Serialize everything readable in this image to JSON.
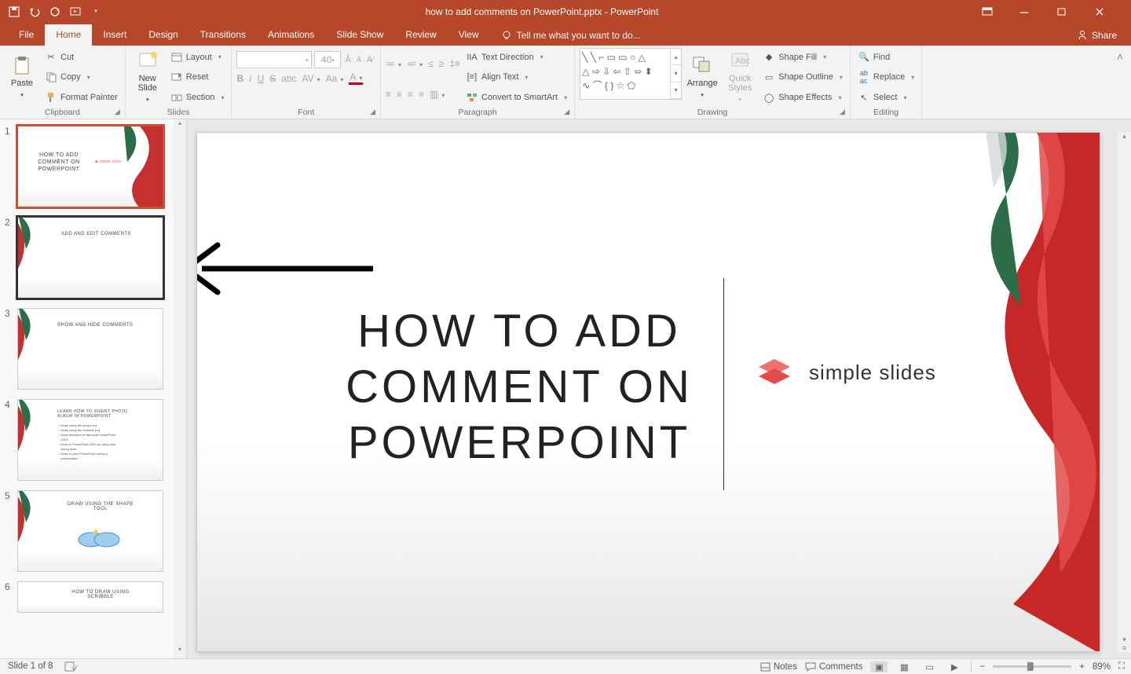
{
  "titlebar": {
    "title": "how to add comments on PowerPoint.pptx - PowerPoint"
  },
  "tabs": {
    "file": "File",
    "home": "Home",
    "insert": "Insert",
    "design": "Design",
    "transitions": "Transitions",
    "animations": "Animations",
    "slideshow": "Slide Show",
    "review": "Review",
    "view": "View",
    "tell": "Tell me what you want to do...",
    "share": "Share"
  },
  "ribbon": {
    "clipboard": {
      "paste": "Paste",
      "cut": "Cut",
      "copy": "Copy",
      "formatpainter": "Format Painter",
      "label": "Clipboard"
    },
    "slides": {
      "newslide": "New\nSlide",
      "layout": "Layout",
      "reset": "Reset",
      "section": "Section",
      "label": "Slides"
    },
    "font": {
      "size": "40",
      "label": "Font"
    },
    "paragraph": {
      "textdir": "Text Direction",
      "align": "Align Text",
      "smartart": "Convert to SmartArt",
      "label": "Paragraph"
    },
    "drawing": {
      "arrange": "Arrange",
      "quickstyles": "Quick\nStyles",
      "shapefill": "Shape Fill",
      "shapeoutline": "Shape Outline",
      "shapeeffects": "Shape Effects",
      "label": "Drawing"
    },
    "editing": {
      "find": "Find",
      "replace": "Replace",
      "select": "Select",
      "label": "Editing"
    }
  },
  "thumbnails": [
    {
      "n": "1",
      "title": "HOW TO ADD\nCOMMENT ON\nPOWERPOINT"
    },
    {
      "n": "2",
      "title": "ADD AND EDIT COMMENTS"
    },
    {
      "n": "3",
      "title": "SHOW AND HIDE COMMENTS"
    },
    {
      "n": "4",
      "title": "LEARN HOW TO INSERT PHOTO\nALBUM IN POWERPOINT"
    },
    {
      "n": "5",
      "title": "DRAW USING THE SHAPE\nTOOL"
    },
    {
      "n": "6",
      "title": "HOW TO DRAW USING\nSCRIBBLE"
    }
  ],
  "slide": {
    "title": "HOW TO ADD\nCOMMENT ON\nPOWERPOINT",
    "logotext": "simple slides"
  },
  "status": {
    "slideof": "Slide 1 of 8",
    "notes": "Notes",
    "comments": "Comments",
    "zoom": "89%"
  }
}
